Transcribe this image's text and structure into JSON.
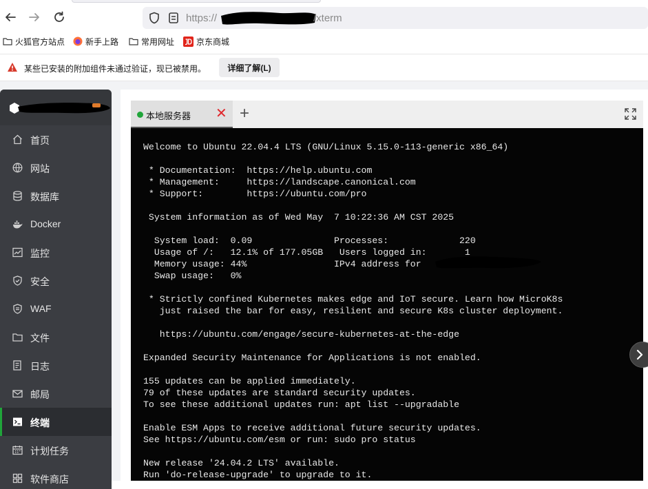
{
  "browser": {
    "url_prefix": "https://",
    "url_suffix": "/xterm",
    "bookmarks": [
      {
        "label": "火狐官方站点",
        "icon": "folder-icon"
      },
      {
        "label": "新手上路",
        "icon": "firefox-icon"
      },
      {
        "label": "常用网址",
        "icon": "folder-icon"
      },
      {
        "label": "京东商城",
        "icon": "jd-icon"
      }
    ],
    "notice": {
      "message": "某些已安装的附加组件未通过验证，现已被禁用。",
      "button": "详细了解(L)"
    }
  },
  "sidebar": {
    "items": [
      {
        "label": "首页",
        "icon": "home-icon"
      },
      {
        "label": "网站",
        "icon": "globe-icon"
      },
      {
        "label": "数据库",
        "icon": "database-icon"
      },
      {
        "label": "Docker",
        "icon": "docker-icon"
      },
      {
        "label": "监控",
        "icon": "monitor-icon"
      },
      {
        "label": "安全",
        "icon": "shield-icon"
      },
      {
        "label": "WAF",
        "icon": "waf-shield-icon"
      },
      {
        "label": "文件",
        "icon": "folder-icon"
      },
      {
        "label": "日志",
        "icon": "log-icon"
      },
      {
        "label": "邮局",
        "icon": "mail-icon"
      },
      {
        "label": "终端",
        "icon": "terminal-icon",
        "active": true
      },
      {
        "label": "计划任务",
        "icon": "calendar-icon"
      },
      {
        "label": "软件商店",
        "icon": "store-icon"
      }
    ]
  },
  "terminal": {
    "tab_label": "本地服务器",
    "close_glyph": "✕",
    "add_glyph": "+",
    "lines": [
      "Welcome to Ubuntu 22.04.4 LTS (GNU/Linux 5.15.0-113-generic x86_64)",
      "",
      " * Documentation:  https://help.ubuntu.com",
      " * Management:     https://landscape.canonical.com",
      " * Support:        https://ubuntu.com/pro",
      "",
      " System information as of Wed May  7 10:22:36 AM CST 2025",
      "",
      "  System load:  0.09               Processes:             220",
      "  Usage of /:   12.1% of 177.05GB   Users logged in:       1",
      "  Memory usage: 44%                IPv4 address for",
      "  Swap usage:   0%",
      "",
      " * Strictly confined Kubernetes makes edge and IoT secure. Learn how MicroK8s",
      "   just raised the bar for easy, resilient and secure K8s cluster deployment.",
      "",
      "   https://ubuntu.com/engage/secure-kubernetes-at-the-edge",
      "",
      "Expanded Security Maintenance for Applications is not enabled.",
      "",
      "155 updates can be applied immediately.",
      "79 of these updates are standard security updates.",
      "To see these additional updates run: apt list --upgradable",
      "",
      "Enable ESM Apps to receive additional future security updates.",
      "See https://ubuntu.com/esm or run: sudo pro status",
      "",
      "New release '24.04.2 LTS' available.",
      "Run 'do-release-upgrade' to upgrade to it."
    ]
  },
  "colors": {
    "accent_green": "#20a53a",
    "close_red": "#e0262b",
    "sidebar_bg": "#3b3d42",
    "terminal_bg": "#050505"
  }
}
